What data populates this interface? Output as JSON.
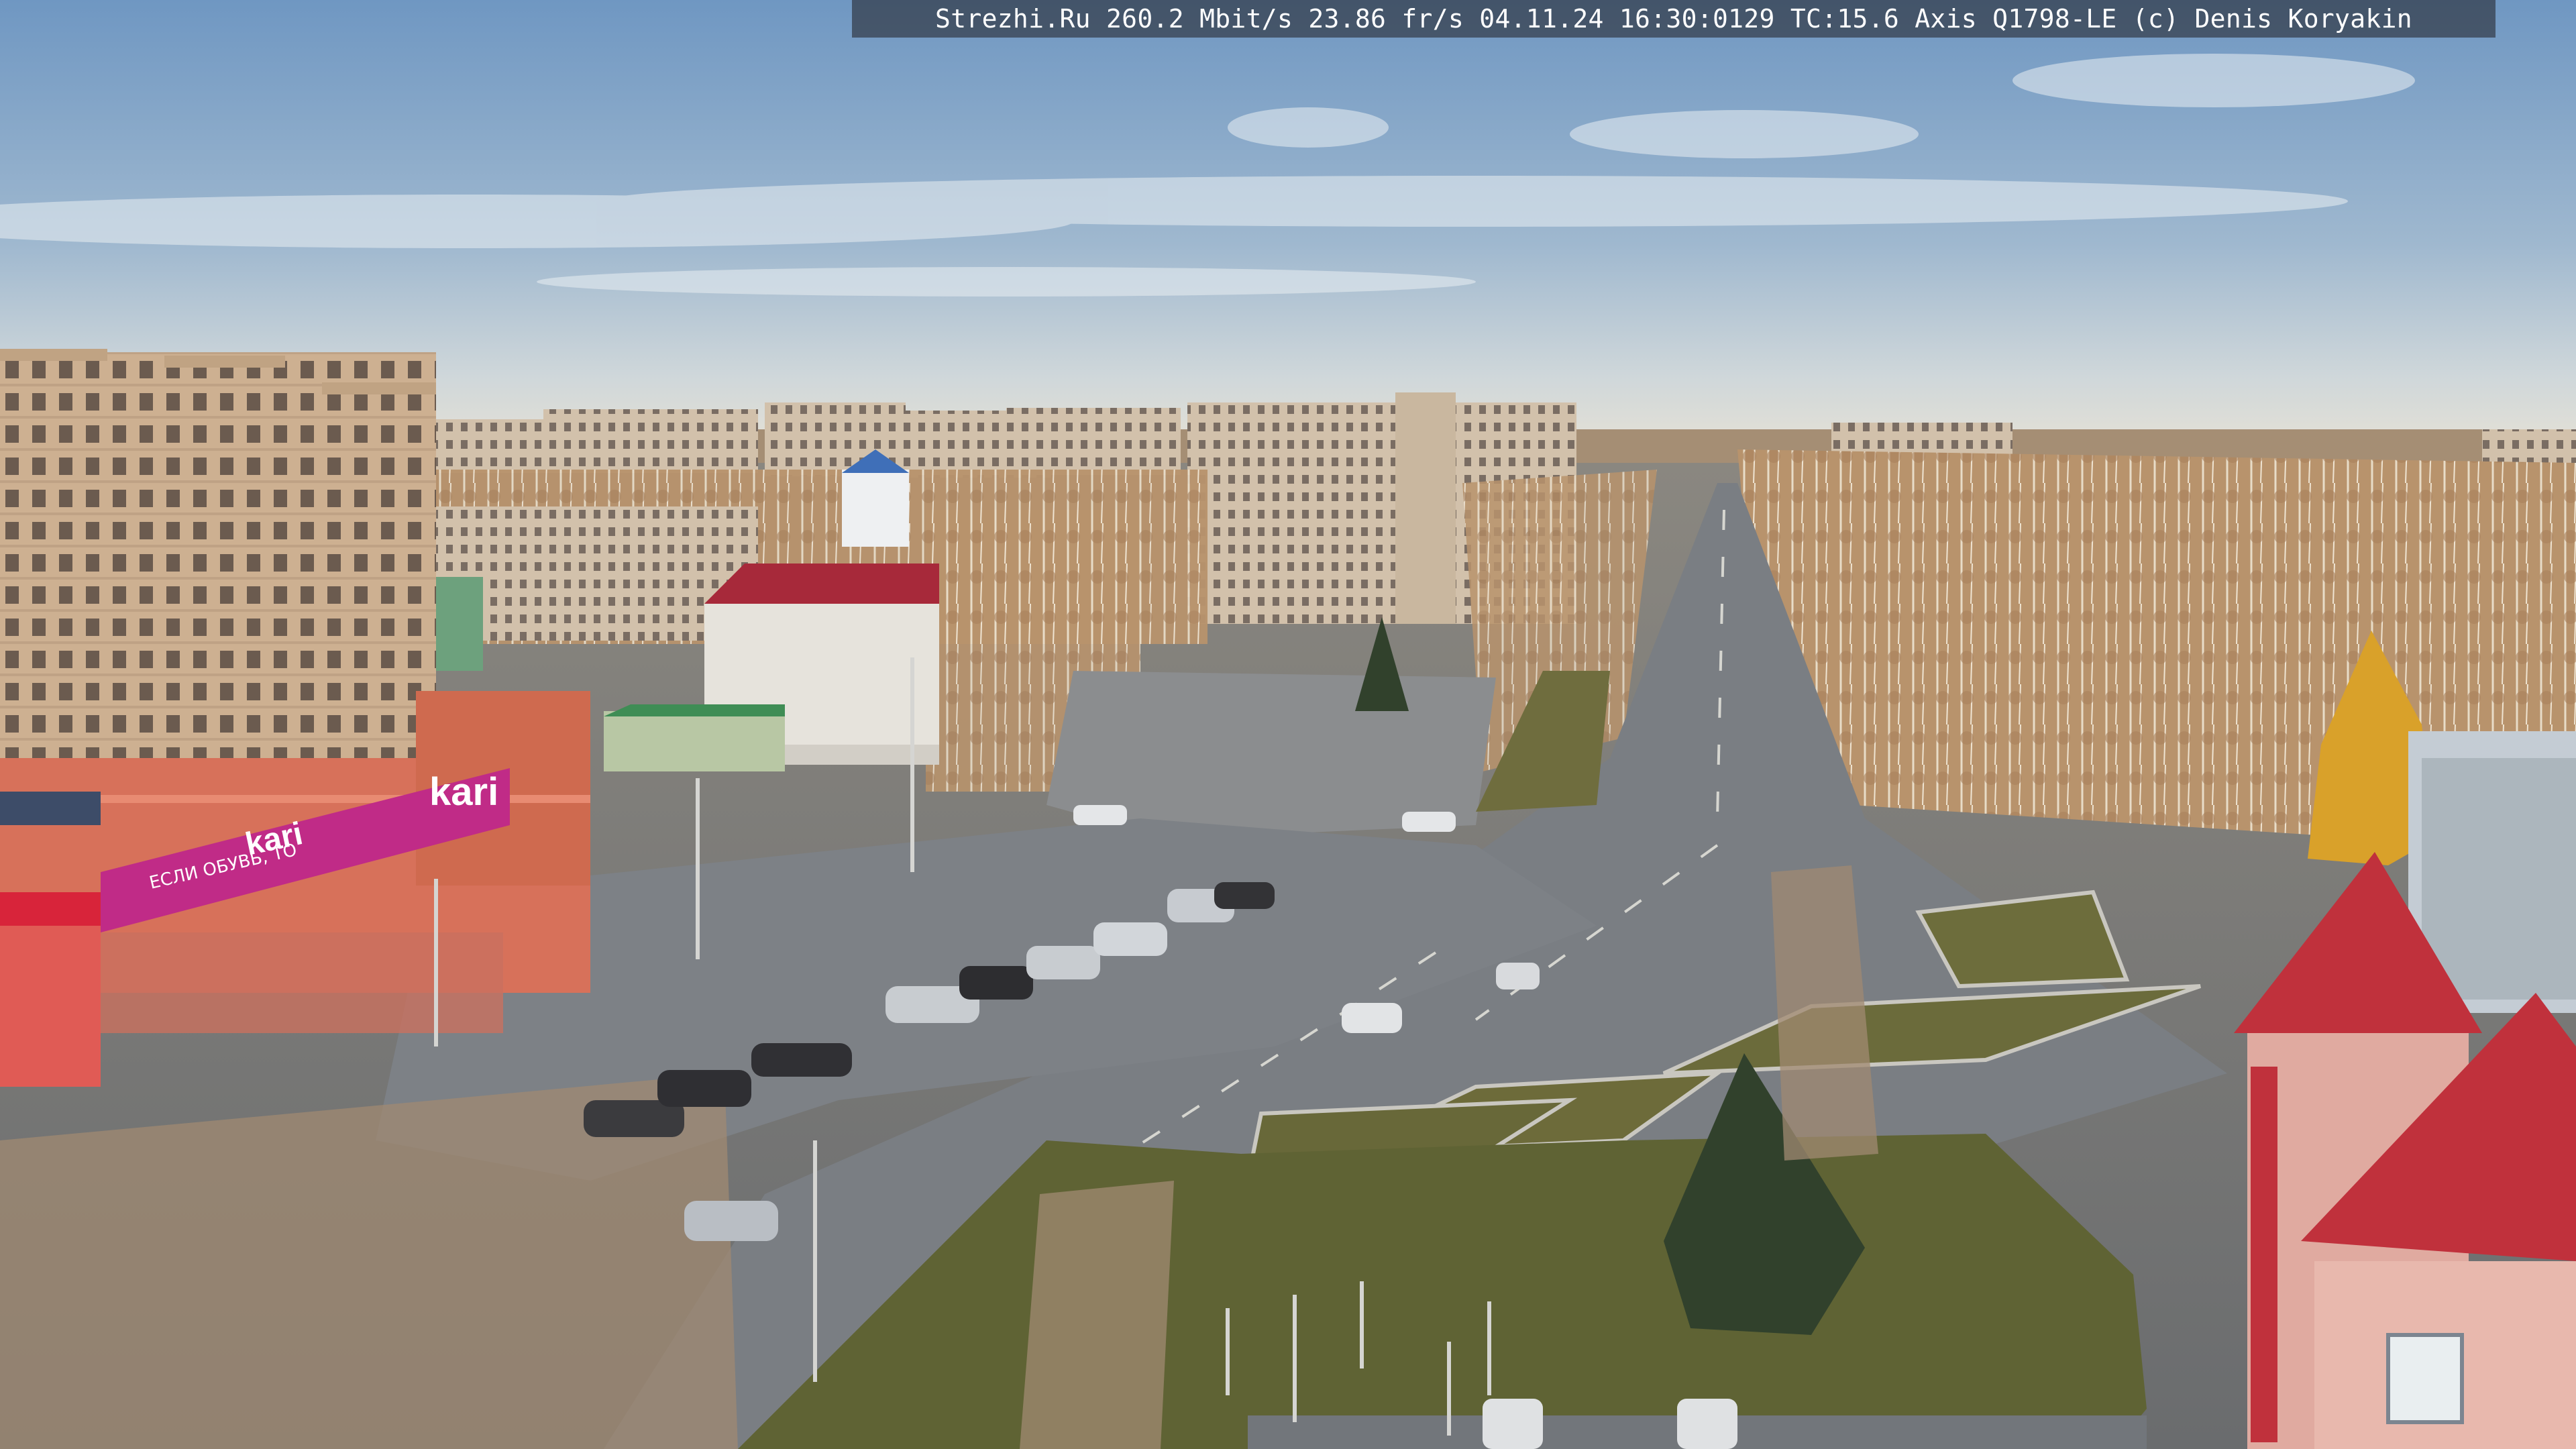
{
  "camera_overlay": {
    "text": "Strezhi.Ru 260.2 Mbit/s 23.86 fr/s 04.11.24 16:30:0129 TC:15.6  Axis Q1798-LE  (c) Denis Koryakin"
  },
  "storefronts": {
    "kari_logo": "kari",
    "kari_logo_small": "kari",
    "kari_banner_line": "ЕСЛИ ОБУВЬ, ТО"
  },
  "colors": {
    "sky_top": "#7fa3c8",
    "sky_horizon": "#dfe3e0",
    "asphalt": "#767a7f",
    "kari_magenta": "#c02b87",
    "roof_red": "#c0313c",
    "grass": "#6d6d3c",
    "birch_bare": "#c8a27a",
    "larch_gold": "#d9a12a"
  }
}
